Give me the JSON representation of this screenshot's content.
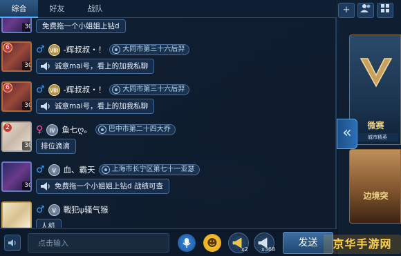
{
  "tabs": [
    {
      "label": "综合",
      "active": true
    },
    {
      "label": "好友",
      "active": false
    },
    {
      "label": "战队",
      "active": false
    }
  ],
  "messages": [
    {
      "type": "top_cut",
      "level": "30",
      "text": "免费拖一个小姐姐上钻d"
    },
    {
      "rank": "6",
      "level": "30",
      "gender": "♂",
      "tier": "VIII",
      "username": "-辉叔叔・！",
      "location": "大同市第三十六后羿",
      "text": "诚意mai号，看上的加我私聊"
    },
    {
      "rank": "6",
      "level": "30",
      "gender": "♂",
      "tier": "VIII",
      "username": "-辉叔叔・！",
      "location": "大同市第三十六后羿",
      "text": "诚意mai号，看上的加我私聊"
    },
    {
      "rank": "2",
      "level": "30",
      "gender": "♀",
      "tier": "IV",
      "username": "鱼七ღ。",
      "location": "巴中市第二十四大乔",
      "text": "排位滴滴"
    },
    {
      "rank": "",
      "level": "30",
      "gender": "♂",
      "tier": "V",
      "username": "血、霸天",
      "location": "上海市长宁区第七十一亚瑟",
      "text": "免费拖一个小姐姐上钻d 战绩可查"
    },
    {
      "rank": "",
      "level": "",
      "gender": "♂",
      "tier": "V",
      "username": "戰犯ψ骚气猴",
      "location": "",
      "text": "人机"
    }
  ],
  "input": {
    "placeholder": "点击输入",
    "send_label": "发送",
    "horn_small_count": "x2",
    "horn_big_count": "x368"
  },
  "side": {
    "card1_title": "微赛",
    "card1_sub": "城市精英",
    "card2_title": "边境突"
  },
  "watermark": "京华手游网",
  "colors": {
    "accent": "#4fb1ff",
    "male": "#3fa4ff",
    "female": "#ff5aa8"
  }
}
